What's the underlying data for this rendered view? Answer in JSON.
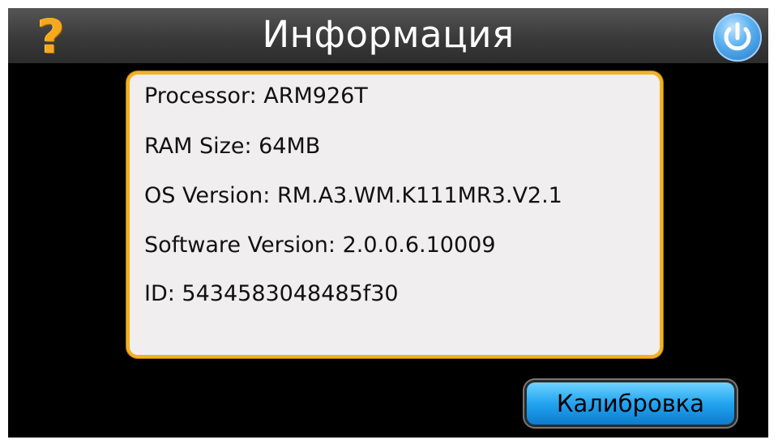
{
  "header": {
    "title": "Информация",
    "help_icon": "question-mark-icon",
    "help_glyph": "?",
    "power_icon": "power-icon",
    "help_color": "#f7a91e",
    "power_color": "#3a9be6"
  },
  "info": {
    "lines": [
      "Processor: ARM926T",
      "RAM Size: 64MB",
      "OS Version:  RM.A3.WM.K111MR3.V2.1",
      "Software Version: 2.0.0.6.10009",
      "ID: 5434583048485f30"
    ],
    "border_color": "#f2b223"
  },
  "actions": {
    "calibration_label": "Калибровка",
    "button_color": "#22a4f0"
  }
}
